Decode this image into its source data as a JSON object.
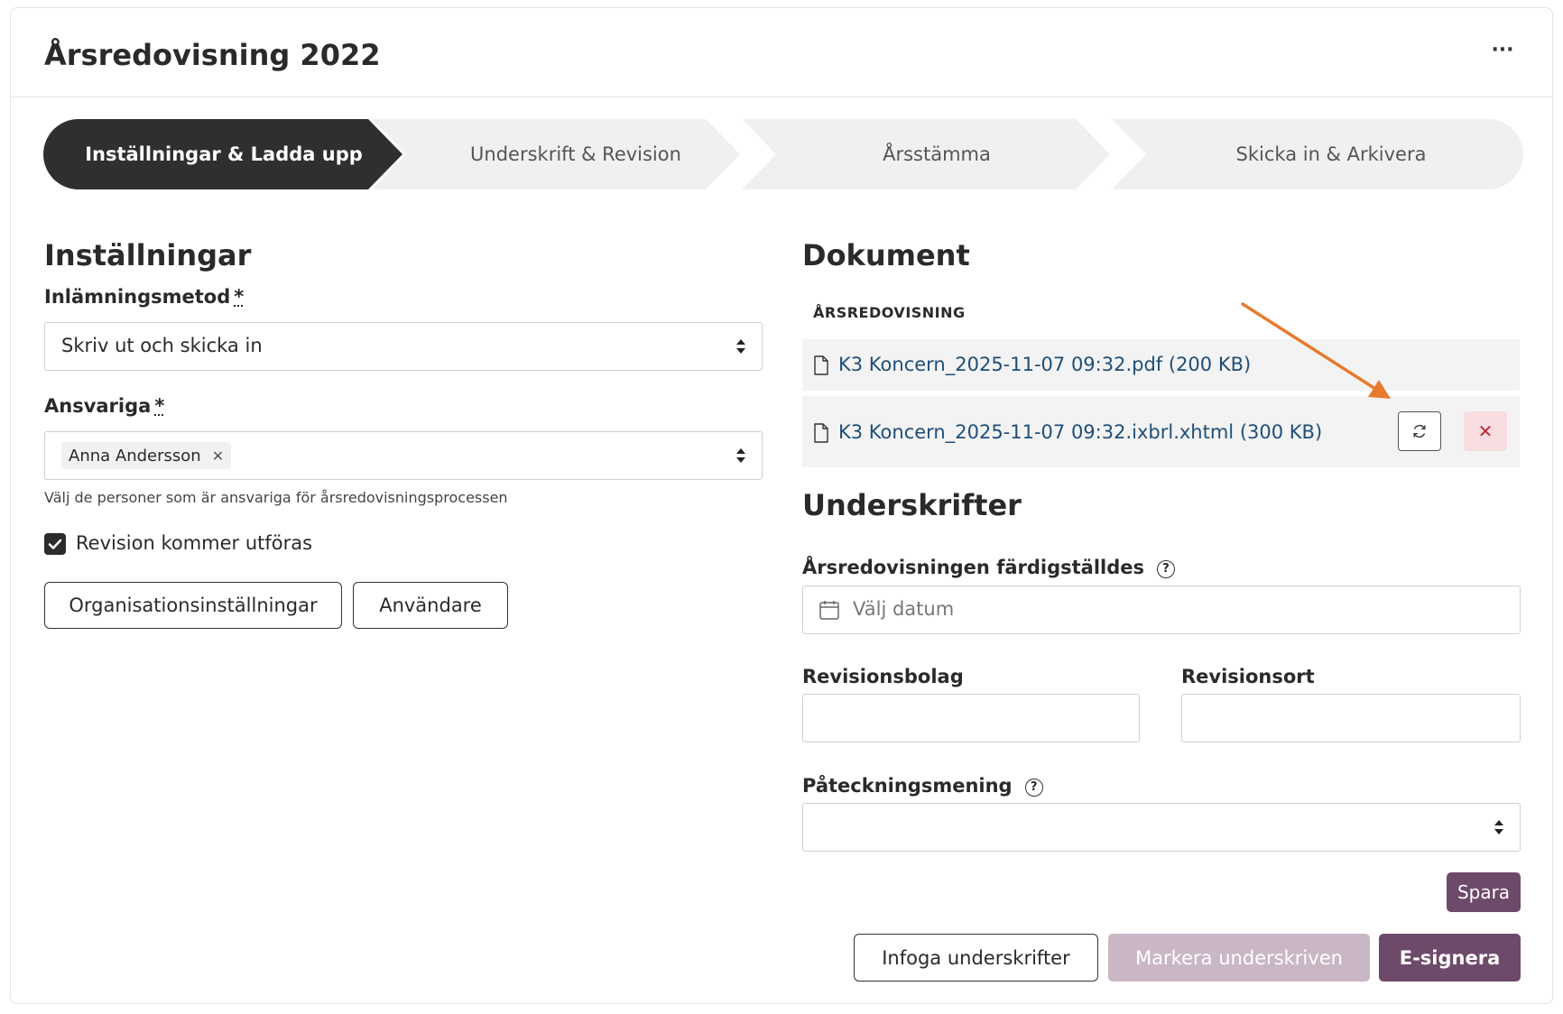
{
  "header": {
    "title": "Årsredovisning 2022",
    "more_label": "···"
  },
  "stepper": {
    "steps": [
      {
        "label": "Inställningar & Ladda upp",
        "active": true
      },
      {
        "label": "Underskrift & Revision",
        "active": false
      },
      {
        "label": "Årsstämma",
        "active": false
      },
      {
        "label": "Skicka in & Arkivera",
        "active": false
      }
    ]
  },
  "settings": {
    "title": "Inställningar",
    "method_label": "Inlämningsmetod",
    "method_value": "Skriv ut och skicka in",
    "responsible_label": "Ansvariga",
    "required_mark": "*",
    "responsible_tag": "Anna Andersson",
    "responsible_help": "Välj de personer som är ansvariga för årsredovisningsprocessen",
    "revision_checkbox_label": "Revision kommer utföras",
    "revision_checked": true,
    "org_settings_button": "Organisationsinställningar",
    "users_button": "Användare"
  },
  "documents": {
    "title": "Dokument",
    "subtitle": "ÅRSREDOVISNING",
    "files": [
      {
        "name": "K3 Koncern_2025-11-07 09:32.pdf (200 KB)"
      },
      {
        "name": "K3 Koncern_2025-11-07 09:32.ixbrl.xhtml (300 KB)"
      }
    ]
  },
  "signatures": {
    "title": "Underskrifter",
    "completed_label": "Årsredovisningen färdigställdes",
    "date_placeholder": "Välj datum",
    "audit_firm_label": "Revisionsbolag",
    "audit_firm_value": "",
    "audit_city_label": "Revisionsort",
    "audit_city_value": "",
    "endorsement_label": "Påteckningsmening",
    "endorsement_value": "",
    "save_button": "Spara"
  },
  "footer": {
    "insert_signatures_button": "Infoga underskrifter",
    "mark_signed_button": "Markera underskriven",
    "esign_button": "E-signera"
  },
  "colors": {
    "primary": "#6e4a6a",
    "primary_disabled": "#c9b7c6",
    "step_active": "#2f2f2f",
    "step_inactive": "#f0f0f0",
    "link": "#1f4e79",
    "delete": "#c0283a",
    "annotation_arrow": "#e87a2e"
  }
}
